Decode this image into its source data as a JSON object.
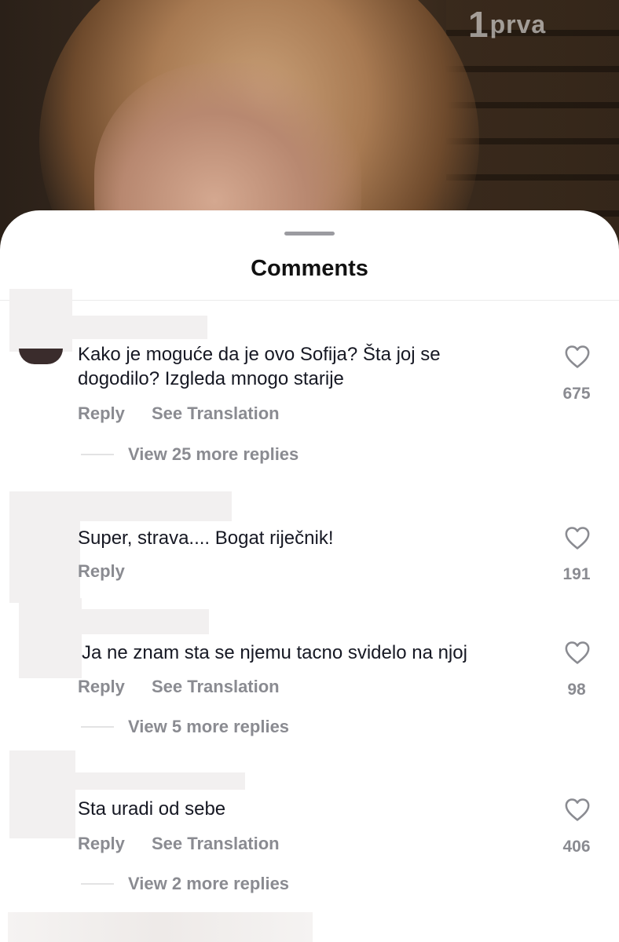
{
  "video": {
    "logo_number": "1",
    "logo_word": "prva"
  },
  "sheet": {
    "title": "Comments"
  },
  "comments": [
    {
      "text_line1": "Kako je moguće da je ovo Sofija? Šta joj se",
      "text_line2": "dogodilo? Izgleda mnogo starije",
      "reply_label": "Reply",
      "translate_label": "See Translation",
      "likes": "675",
      "replies_label": "View 25 more replies"
    },
    {
      "text_line1": "Super, strava.... Bogat riječnik!",
      "reply_label": "Reply",
      "likes": "191"
    },
    {
      "text_line1": "Ja ne znam sta se njemu tacno svidelo na njoj",
      "reply_label": "Reply",
      "translate_label": "See Translation",
      "likes": "98",
      "replies_label": "View 5 more replies"
    },
    {
      "text_line1": "Sta uradi od sebe",
      "reply_label": "Reply",
      "translate_label": "See Translation",
      "likes": "406",
      "replies_label": "View 2 more replies"
    }
  ]
}
